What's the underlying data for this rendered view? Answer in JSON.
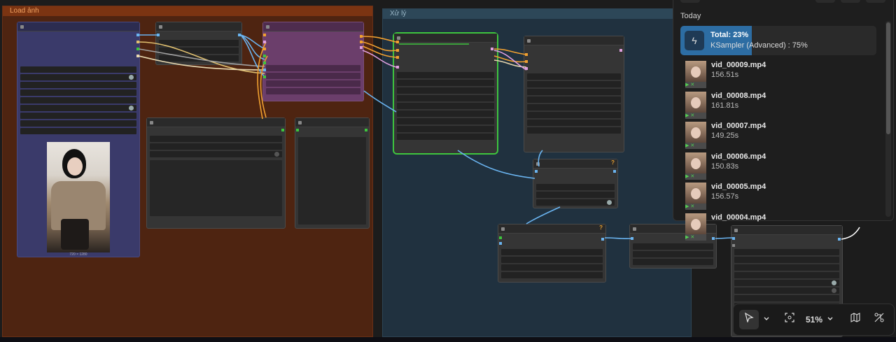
{
  "groups": {
    "load": {
      "title": "Load ảnh",
      "color": "#7b3412"
    },
    "process": {
      "title": "Xử lý",
      "color": "#2d4758"
    }
  },
  "image_preview": {
    "caption": "720 × 1280"
  },
  "queue": {
    "section_label": "Today",
    "progress": {
      "total_label": "Total: 23%",
      "total_fraction": 0.23,
      "step_label": "KSampler (Advanced) : 75%",
      "icon": "lightning-icon"
    },
    "items": [
      {
        "name": "vid_00009.mp4",
        "time": "156.51s"
      },
      {
        "name": "vid_00008.mp4",
        "time": "161.81s"
      },
      {
        "name": "vid_00007.mp4",
        "time": "149.25s"
      },
      {
        "name": "vid_00006.mp4",
        "time": "150.83s"
      },
      {
        "name": "vid_00005.mp4",
        "time": "156.57s"
      },
      {
        "name": "vid_00004.mp4",
        "time": ""
      }
    ]
  },
  "toolbar": {
    "select_icon": "pointer-icon",
    "fit_icon": "focus-icon",
    "zoom": "51%",
    "minimap_icon": "map-icon",
    "links_icon": "link-toggle-icon"
  },
  "colors": {
    "accent": "#2d6da3",
    "selected_node": "#3ec43e"
  }
}
